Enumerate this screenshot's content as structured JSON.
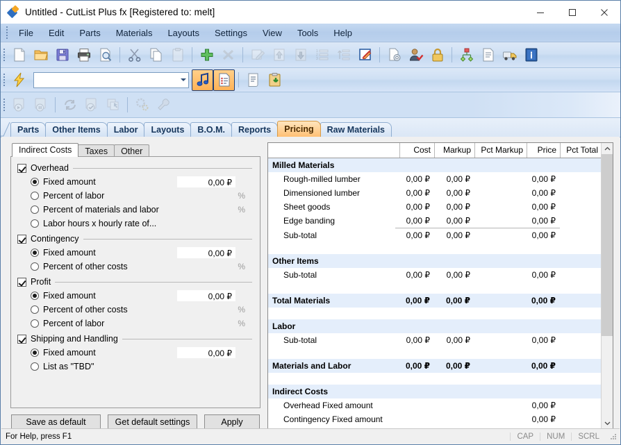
{
  "window": {
    "title": "Untitled - CutList Plus fx [Registered to: melt]",
    "app_icon": "cutlist-diamond-icon",
    "controls": {
      "minimize": "minimize-icon",
      "maximize": "maximize-icon",
      "close": "close-icon"
    }
  },
  "menubar": {
    "items": [
      "File",
      "Edit",
      "Parts",
      "Materials",
      "Layouts",
      "Settings",
      "View",
      "Tools",
      "Help"
    ]
  },
  "toolbar_main": {
    "buttons": [
      {
        "name": "new-icon",
        "enabled": true
      },
      {
        "name": "open-folder-icon",
        "enabled": true
      },
      {
        "name": "save-floppy-icon",
        "enabled": true
      },
      {
        "name": "print-icon",
        "enabled": true
      },
      {
        "name": "print-preview-icon",
        "enabled": true
      },
      {
        "name": "cut-scissors-icon",
        "enabled": true
      },
      {
        "name": "copy-icon",
        "enabled": true
      },
      {
        "name": "paste-icon",
        "enabled": false
      },
      {
        "name": "add-plus-icon",
        "enabled": true
      },
      {
        "name": "delete-x-icon",
        "enabled": false
      },
      {
        "name": "edit-pencil-icon",
        "enabled": false
      },
      {
        "name": "move-up-icon",
        "enabled": false
      },
      {
        "name": "move-down-icon",
        "enabled": false
      },
      {
        "name": "list-numbered-icon",
        "enabled": false
      },
      {
        "name": "sort-ascending-icon",
        "enabled": false
      },
      {
        "name": "edit-note-icon",
        "enabled": true
      },
      {
        "name": "document-settings-icon",
        "enabled": true
      },
      {
        "name": "user-check-icon",
        "enabled": true
      },
      {
        "name": "lock-icon",
        "enabled": true
      },
      {
        "name": "hierarchy-icon",
        "enabled": true
      },
      {
        "name": "report-page-icon",
        "enabled": true
      },
      {
        "name": "truck-shipping-icon",
        "enabled": true
      },
      {
        "name": "info-icon",
        "enabled": true
      }
    ]
  },
  "toolbar_quick": {
    "lightning_icon": "lightning-bolt-icon",
    "combo_value": "",
    "combo_placeholder": "",
    "buttons": [
      {
        "name": "optimize-note-icon",
        "enabled": true,
        "selected": true
      },
      {
        "name": "parts-list-icon",
        "enabled": true,
        "selected": true
      },
      {
        "name": "scroll-report-icon",
        "enabled": true,
        "selected": false
      },
      {
        "name": "clipboard-download-icon",
        "enabled": true,
        "selected": false
      }
    ]
  },
  "toolbar_layout": {
    "buttons": [
      {
        "name": "layout-play-icon",
        "enabled": false
      },
      {
        "name": "layout-pause-icon",
        "enabled": false
      },
      {
        "name": "layout-refresh-icon",
        "enabled": false
      },
      {
        "name": "layout-check-icon",
        "enabled": false
      },
      {
        "name": "layout-select-icon",
        "enabled": false
      },
      {
        "name": "layout-settings-gear-icon",
        "enabled": false
      },
      {
        "name": "layout-wrench-icon",
        "enabled": false
      }
    ]
  },
  "tabs": {
    "items": [
      {
        "label": "Parts",
        "active": false
      },
      {
        "label": "Other Items",
        "active": false
      },
      {
        "label": "Labor",
        "active": false
      },
      {
        "label": "Layouts",
        "active": false
      },
      {
        "label": "B.O.M.",
        "active": false
      },
      {
        "label": "Reports",
        "active": false
      },
      {
        "label": "Pricing",
        "active": true
      },
      {
        "label": "Raw Materials",
        "active": false
      }
    ]
  },
  "left_panel": {
    "subtabs": [
      {
        "label": "Indirect Costs",
        "active": true
      },
      {
        "label": "Taxes",
        "active": false
      },
      {
        "label": "Other",
        "active": false
      }
    ],
    "groups": [
      {
        "label": "Overhead",
        "checked": true,
        "options": [
          {
            "label": "Fixed amount",
            "selected": true,
            "value": "0,00 ₽",
            "type": "currency"
          },
          {
            "label": "Percent of labor",
            "selected": false,
            "value": "%",
            "type": "percent"
          },
          {
            "label": "Percent of materials and labor",
            "selected": false,
            "value": "%",
            "type": "percent"
          },
          {
            "label": "Labor hours x hourly rate of...",
            "selected": false,
            "value": "",
            "type": "none"
          }
        ]
      },
      {
        "label": "Contingency",
        "checked": true,
        "options": [
          {
            "label": "Fixed amount",
            "selected": true,
            "value": "0,00 ₽",
            "type": "currency"
          },
          {
            "label": "Percent of other costs",
            "selected": false,
            "value": "%",
            "type": "percent"
          }
        ]
      },
      {
        "label": "Profit",
        "checked": true,
        "options": [
          {
            "label": "Fixed amount",
            "selected": true,
            "value": "0,00 ₽",
            "type": "currency"
          },
          {
            "label": "Percent of other costs",
            "selected": false,
            "value": "%",
            "type": "percent"
          },
          {
            "label": "Percent of labor",
            "selected": false,
            "value": "%",
            "type": "percent"
          }
        ]
      },
      {
        "label": "Shipping and Handling",
        "checked": true,
        "options": [
          {
            "label": "Fixed amount",
            "selected": true,
            "value": "0,00 ₽",
            "type": "currency"
          },
          {
            "label": "List as \"TBD\"",
            "selected": false,
            "value": "",
            "type": "none"
          }
        ]
      }
    ],
    "buttons": [
      {
        "label": "Save as default"
      },
      {
        "label": "Get default settings"
      },
      {
        "label": "Apply"
      }
    ]
  },
  "grid": {
    "columns": [
      "",
      "Cost",
      "Markup",
      "Pct Markup",
      "Price",
      "Pct Total"
    ],
    "rows": [
      {
        "kind": "section",
        "name": "Milled Materials",
        "cost": "",
        "markup": "",
        "pct_markup": "",
        "price": "",
        "pct_total": ""
      },
      {
        "kind": "item",
        "name": "Rough-milled lumber",
        "cost": "0,00 ₽",
        "markup": "0,00 ₽",
        "pct_markup": "",
        "price": "0,00 ₽",
        "pct_total": ""
      },
      {
        "kind": "item",
        "name": "Dimensioned lumber",
        "cost": "0,00 ₽",
        "markup": "0,00 ₽",
        "pct_markup": "",
        "price": "0,00 ₽",
        "pct_total": ""
      },
      {
        "kind": "item",
        "name": "Sheet goods",
        "cost": "0,00 ₽",
        "markup": "0,00 ₽",
        "pct_markup": "",
        "price": "0,00 ₽",
        "pct_total": ""
      },
      {
        "kind": "item",
        "name": "Edge banding",
        "cost": "0,00 ₽",
        "markup": "0,00 ₽",
        "pct_markup": "",
        "price": "0,00 ₽",
        "pct_total": ""
      },
      {
        "kind": "subtotal",
        "name": "Sub-total",
        "cost": "0,00 ₽",
        "markup": "0,00 ₽",
        "pct_markup": "",
        "price": "0,00 ₽",
        "pct_total": ""
      },
      {
        "kind": "blank",
        "name": "",
        "cost": "",
        "markup": "",
        "pct_markup": "",
        "price": "",
        "pct_total": ""
      },
      {
        "kind": "section",
        "name": "Other Items",
        "cost": "",
        "markup": "",
        "pct_markup": "",
        "price": "",
        "pct_total": ""
      },
      {
        "kind": "item",
        "name": "Sub-total",
        "cost": "0,00 ₽",
        "markup": "0,00 ₽",
        "pct_markup": "",
        "price": "0,00 ₽",
        "pct_total": ""
      },
      {
        "kind": "blank",
        "name": "",
        "cost": "",
        "markup": "",
        "pct_markup": "",
        "price": "",
        "pct_total": ""
      },
      {
        "kind": "section",
        "name": "Total Materials",
        "cost": "0,00 ₽",
        "markup": "0,00 ₽",
        "pct_markup": "",
        "price": "0,00 ₽",
        "pct_total": ""
      },
      {
        "kind": "blank",
        "name": "",
        "cost": "",
        "markup": "",
        "pct_markup": "",
        "price": "",
        "pct_total": ""
      },
      {
        "kind": "section",
        "name": "Labor",
        "cost": "",
        "markup": "",
        "pct_markup": "",
        "price": "",
        "pct_total": ""
      },
      {
        "kind": "item",
        "name": "Sub-total",
        "cost": "0,00 ₽",
        "markup": "0,00 ₽",
        "pct_markup": "",
        "price": "0,00 ₽",
        "pct_total": ""
      },
      {
        "kind": "blank",
        "name": "",
        "cost": "",
        "markup": "",
        "pct_markup": "",
        "price": "",
        "pct_total": ""
      },
      {
        "kind": "section",
        "name": "Materials and Labor",
        "cost": "0,00 ₽",
        "markup": "0,00 ₽",
        "pct_markup": "",
        "price": "0,00 ₽",
        "pct_total": ""
      },
      {
        "kind": "blank",
        "name": "",
        "cost": "",
        "markup": "",
        "pct_markup": "",
        "price": "",
        "pct_total": ""
      },
      {
        "kind": "section",
        "name": "Indirect Costs",
        "cost": "",
        "markup": "",
        "pct_markup": "",
        "price": "",
        "pct_total": ""
      },
      {
        "kind": "item",
        "name": "Overhead Fixed amount",
        "cost": "",
        "markup": "",
        "pct_markup": "",
        "price": "0,00 ₽",
        "pct_total": ""
      },
      {
        "kind": "item",
        "name": "Contingency Fixed amount",
        "cost": "",
        "markup": "",
        "pct_markup": "",
        "price": "0,00 ₽",
        "pct_total": ""
      }
    ],
    "scrollbar": {
      "up": "scroll-up-icon",
      "down": "scroll-down-icon"
    }
  },
  "statusbar": {
    "help_text": "For Help, press F1",
    "indicators": [
      "CAP",
      "NUM",
      "SCRL"
    ]
  }
}
